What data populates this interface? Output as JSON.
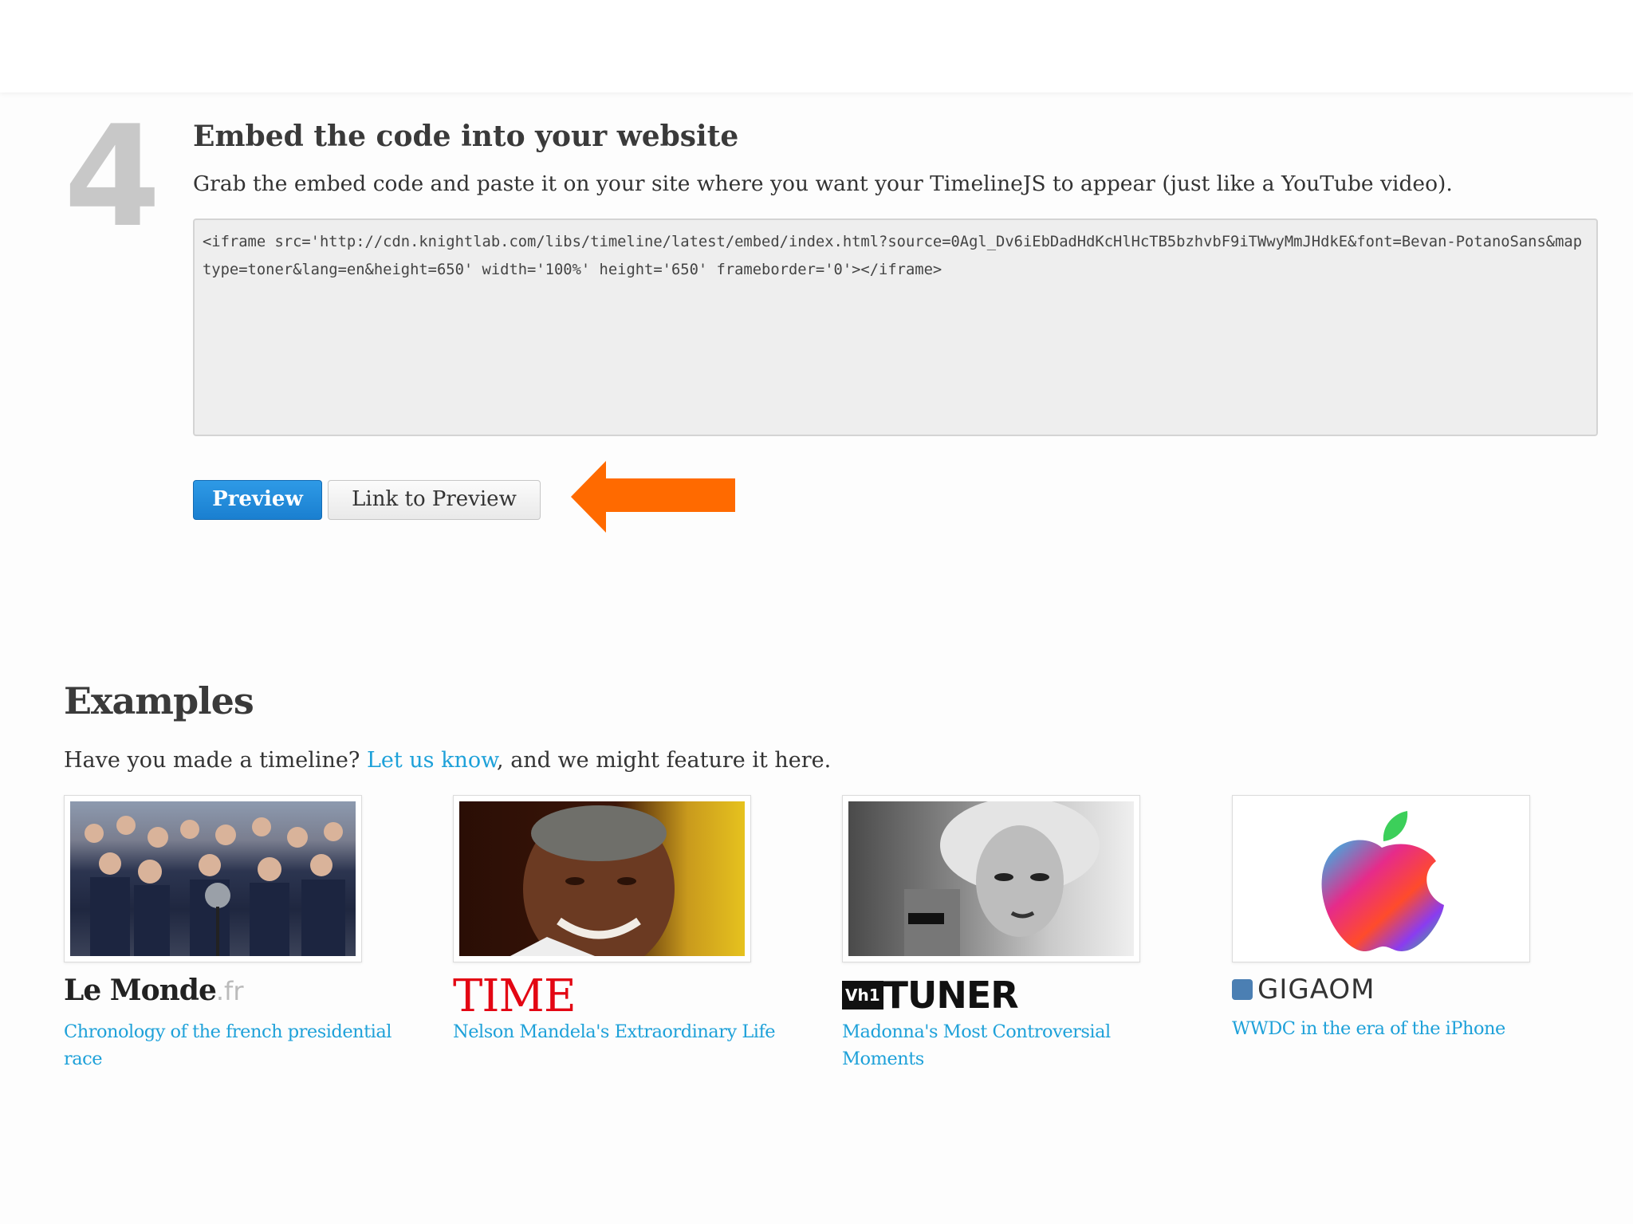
{
  "step": {
    "number": "4",
    "title": "Embed the code into your website",
    "description": "Grab the embed code and paste it on your site where you want your TimelineJS to appear (just like a YouTube video).",
    "embed_code": "<iframe src='http://cdn.knightlab.com/libs/timeline/latest/embed/index.html?source=0Agl_Dv6iEbDadHdKcHlHcTB5bzhvbF9iTWwyMmJHdkE&font=Bevan-PotanoSans&maptype=toner&lang=en&height=650' width='100%' height='650' frameborder='0'></iframe>",
    "preview_label": "Preview",
    "link_preview_label": "Link to Preview",
    "arrow_color": "#ff6a00"
  },
  "examples": {
    "title": "Examples",
    "intro_before": "Have you made a timeline? ",
    "intro_link": "Let us know",
    "intro_after": ", and we might feature it here.",
    "items": [
      {
        "logo": "Le Monde",
        "logo_suffix": ".fr",
        "link": "Chronology of the french presidential race",
        "thumb_icon": "crowd-photo"
      },
      {
        "logo": "TIME",
        "link": "Nelson Mandela's Extraordinary Life",
        "thumb_icon": "portrait-photo"
      },
      {
        "logo_badge": "Vh1",
        "logo": "TUNER",
        "link": "Madonna's Most Controversial Moments",
        "thumb_icon": "bw-portrait-photo"
      },
      {
        "logo": "GIGAOM",
        "link": "WWDC in the era of the iPhone",
        "thumb_icon": "apple-logo"
      }
    ]
  },
  "colors": {
    "link": "#1ea1d9",
    "button_primary": "#1a7fd0",
    "time_red": "#e30613"
  }
}
